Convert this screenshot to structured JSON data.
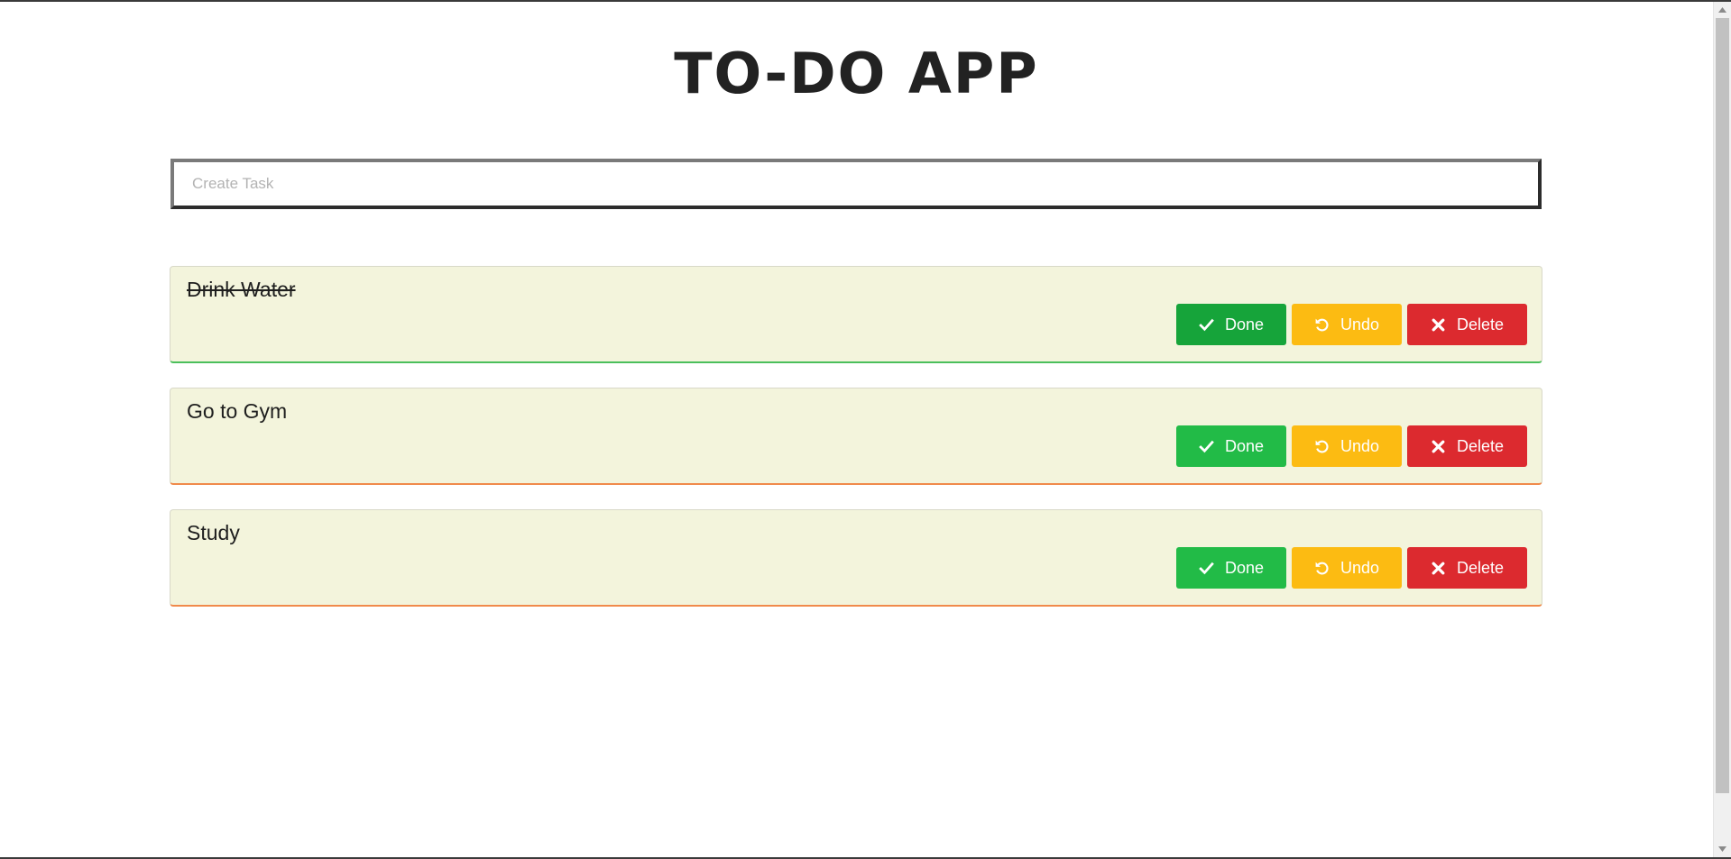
{
  "app": {
    "title": "TO-DO APP"
  },
  "input": {
    "placeholder": "Create Task",
    "value": ""
  },
  "tasks": [
    {
      "text": "Drink Water",
      "completed": true
    },
    {
      "text": "Go to Gym",
      "completed": false
    },
    {
      "text": "Study",
      "completed": false
    }
  ],
  "buttons": {
    "done_label": "Done",
    "undo_label": "Undo",
    "delete_label": "Delete",
    "done_icon": "check-icon",
    "undo_icon": "undo-icon",
    "delete_icon": "close-icon"
  },
  "colors": {
    "done_button": "#22bb47",
    "undo_button": "#fcbb12",
    "delete_button": "#dc2a2f",
    "card_background": "#f3f4dc",
    "completed_border": "#4bbf5b",
    "pending_border": "#f08a4b"
  }
}
